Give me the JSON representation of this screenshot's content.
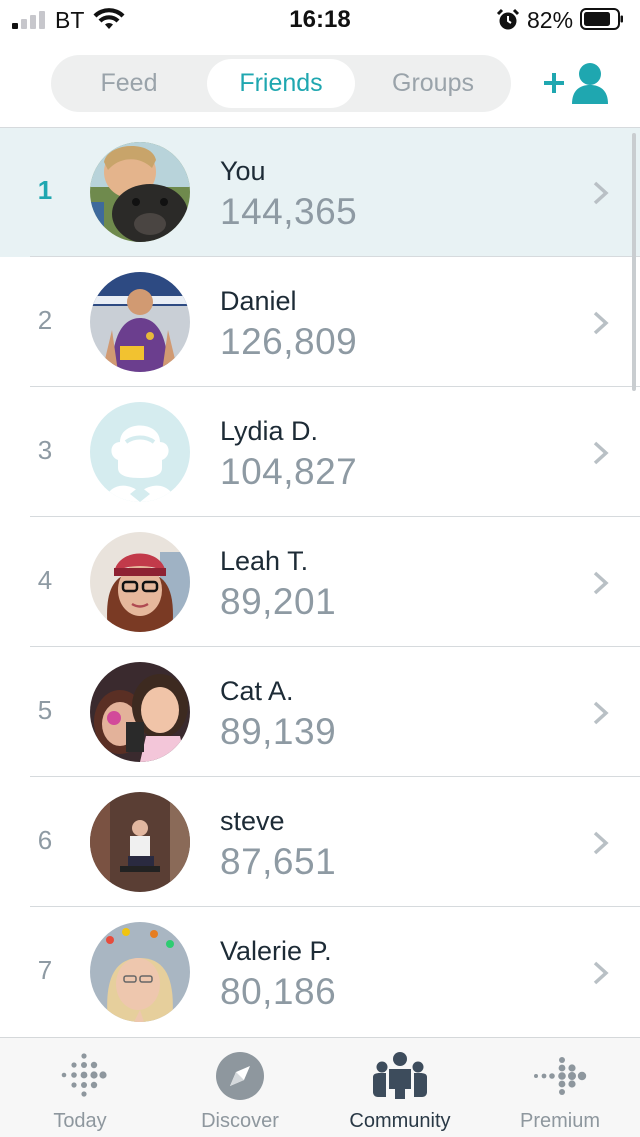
{
  "status": {
    "carrier": "BT",
    "time": "16:18",
    "battery": "82%"
  },
  "segment": {
    "tabs": [
      {
        "label": "Feed"
      },
      {
        "label": "Friends"
      },
      {
        "label": "Groups"
      }
    ],
    "selected": "Friends"
  },
  "leaderboard": [
    {
      "rank": "1",
      "name": "You",
      "steps": "144,365"
    },
    {
      "rank": "2",
      "name": "Daniel",
      "steps": "126,809"
    },
    {
      "rank": "3",
      "name": "Lydia D.",
      "steps": "104,827"
    },
    {
      "rank": "4",
      "name": "Leah T.",
      "steps": "89,201"
    },
    {
      "rank": "5",
      "name": "Cat A.",
      "steps": "89,139"
    },
    {
      "rank": "6",
      "name": "steve",
      "steps": "87,651"
    },
    {
      "rank": "7",
      "name": "Valerie P.",
      "steps": "80,186"
    }
  ],
  "tabbar": {
    "items": [
      {
        "label": "Today",
        "icon": "fitbit-dots-icon"
      },
      {
        "label": "Discover",
        "icon": "compass-icon"
      },
      {
        "label": "Community",
        "icon": "people-icon"
      },
      {
        "label": "Premium",
        "icon": "fitbit-premium-icon"
      }
    ],
    "active": "Community"
  },
  "colors": {
    "accent": "#1fa7b0",
    "selected_row": "#e8f2f4",
    "secondary_text": "#8e9aa3"
  }
}
